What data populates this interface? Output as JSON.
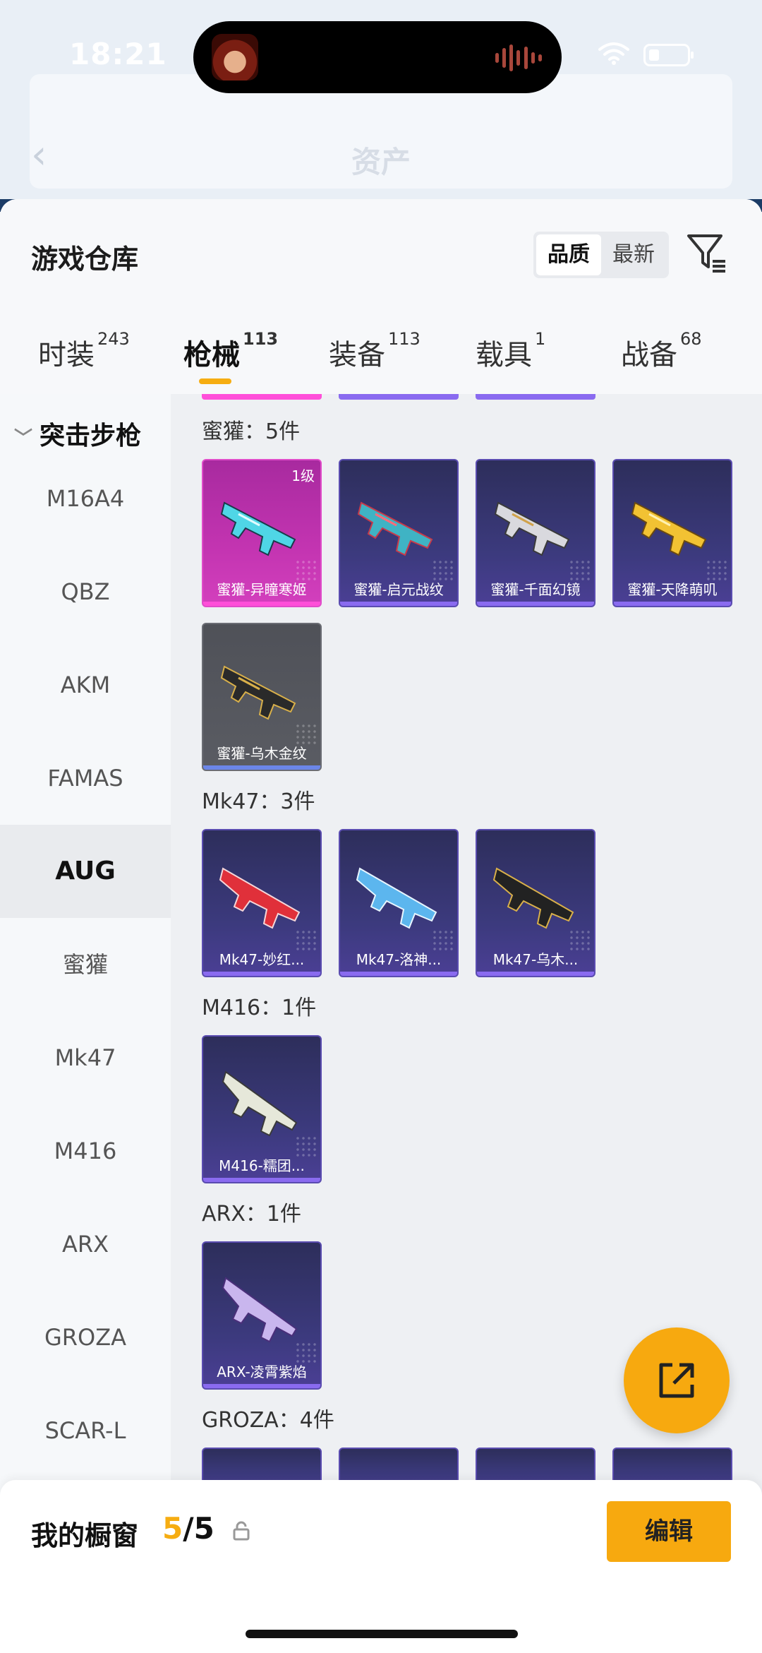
{
  "status_bar": {
    "time": "18:21"
  },
  "background": {
    "title": "资产"
  },
  "sheet": {
    "title": "游戏仓库",
    "sort_options": [
      "品质",
      "最新"
    ],
    "tabs": [
      {
        "label": "时装",
        "count": "243"
      },
      {
        "label": "枪械",
        "count": "113"
      },
      {
        "label": "装备",
        "count": "113"
      },
      {
        "label": "载具",
        "count": "1"
      },
      {
        "label": "战备",
        "count": "68"
      }
    ]
  },
  "sidebar": {
    "group": "突击步枪",
    "items": [
      "M16A4",
      "QBZ",
      "AKM",
      "FAMAS",
      "AUG",
      "蜜獾",
      "Mk47",
      "M416",
      "ARX",
      "GROZA",
      "SCAR-L"
    ],
    "active": "AUG"
  },
  "sections": [
    {
      "label": "蜜獾：5件",
      "items": [
        {
          "name": "蜜獾-异瞳寒姬",
          "level": "1级"
        },
        {
          "name": "蜜獾-启元战纹"
        },
        {
          "name": "蜜獾-千面幻镜"
        },
        {
          "name": "蜜獾-天降萌叽"
        },
        {
          "name": "蜜獾-乌木金纹"
        }
      ]
    },
    {
      "label": "Mk47：3件",
      "items": [
        {
          "name": "Mk47-妙红..."
        },
        {
          "name": "Mk47-洛神..."
        },
        {
          "name": "Mk47-乌木..."
        }
      ]
    },
    {
      "label": "M416：1件",
      "items": [
        {
          "name": "M416-糯团..."
        }
      ]
    },
    {
      "label": "ARX：1件",
      "items": [
        {
          "name": "ARX-凌霄紫焰"
        }
      ]
    },
    {
      "label": "GROZA：4件",
      "items": []
    }
  ],
  "showcase": {
    "label": "我的橱窗",
    "current": "5",
    "total": "/5",
    "edit_label": "编辑"
  },
  "colors": {
    "accent": "#f7a90f",
    "card_purple": "#3c3a7e",
    "card_pink": "#c334b1"
  }
}
